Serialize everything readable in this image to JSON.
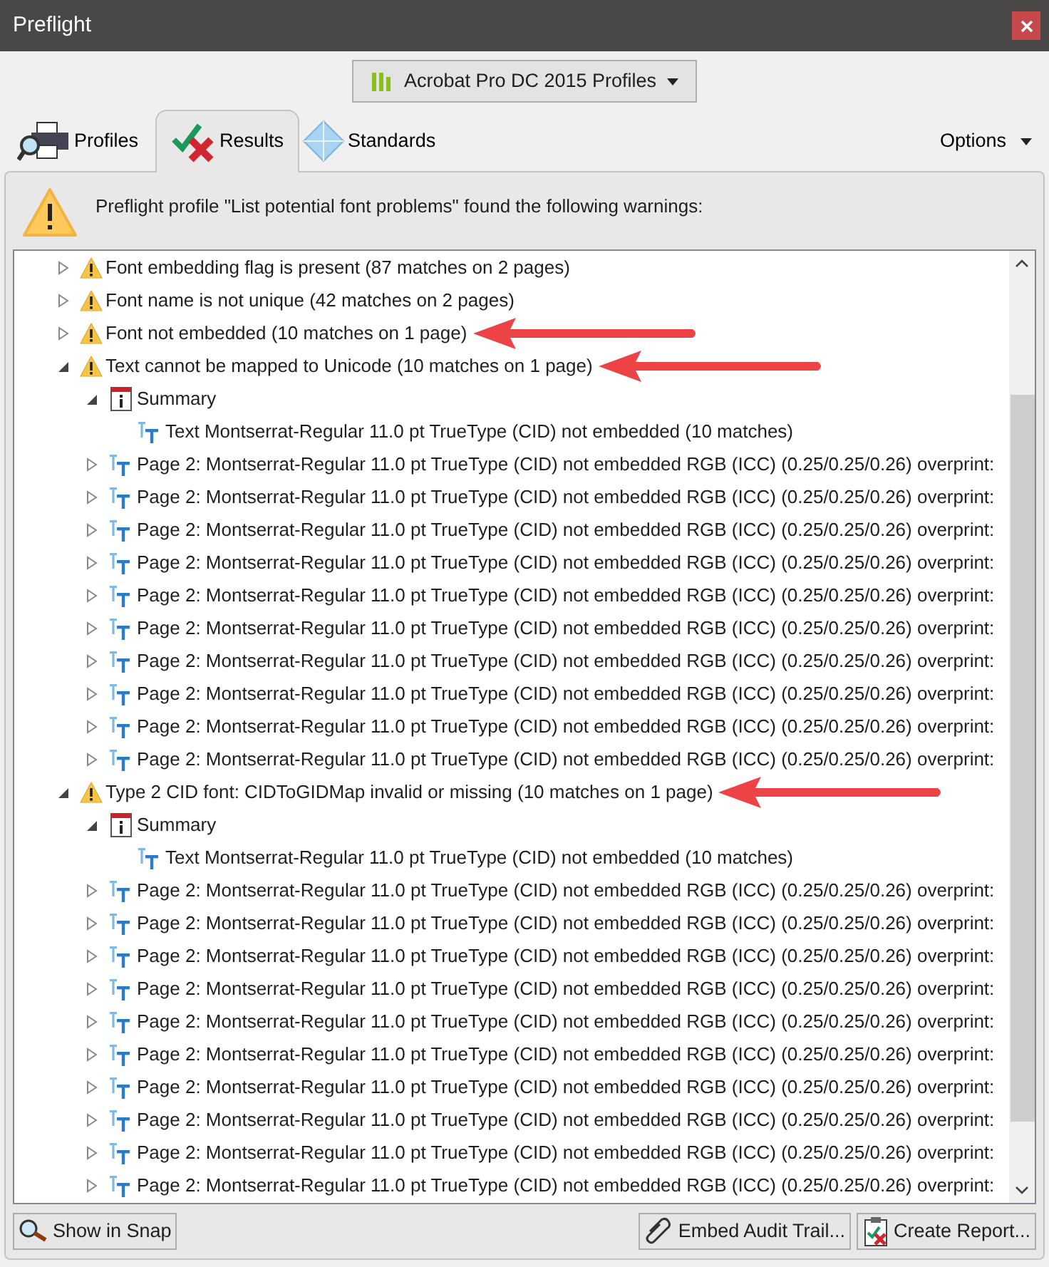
{
  "window": {
    "title": "Preflight"
  },
  "profile_selector": {
    "label": "Acrobat Pro DC 2015 Profiles"
  },
  "tabs": [
    {
      "kind": "profiles",
      "label": "Profiles",
      "selected": false
    },
    {
      "kind": "results",
      "label": "Results",
      "selected": true
    },
    {
      "kind": "standards",
      "label": "Standards",
      "selected": false
    }
  ],
  "options_menu": {
    "label": "Options"
  },
  "message": "Preflight profile \"List potential font problems\" found the following warnings:",
  "results": [
    {
      "kind": "warning",
      "label": "Font embedding flag is present (87 matches on 2 pages)",
      "expanded": false,
      "annotated": false
    },
    {
      "kind": "warning",
      "label": "Font name is not unique (42 matches on 2 pages)",
      "expanded": false,
      "annotated": false
    },
    {
      "kind": "warning",
      "label": "Font not embedded (10 matches on 1 page)",
      "expanded": false,
      "annotated": true
    },
    {
      "kind": "warning",
      "label": "Text cannot be mapped to Unicode (10 matches on 1 page)",
      "expanded": true,
      "annotated": true,
      "children": [
        {
          "kind": "summary",
          "label": "Summary",
          "expanded": true,
          "children": [
            {
              "kind": "text",
              "label": "Text Montserrat-Regular 11.0 pt TrueType (CID) not embedded (10 matches)"
            }
          ]
        },
        {
          "kind": "text",
          "label": "Page 2: Montserrat-Regular 11.0 pt TrueType (CID) not embedded RGB (ICC) (0.25/0.25/0.26)  overprint:",
          "expanded": false
        },
        {
          "kind": "text",
          "label": "Page 2: Montserrat-Regular 11.0 pt TrueType (CID) not embedded RGB (ICC) (0.25/0.25/0.26)  overprint:",
          "expanded": false
        },
        {
          "kind": "text",
          "label": "Page 2: Montserrat-Regular 11.0 pt TrueType (CID) not embedded RGB (ICC) (0.25/0.25/0.26)  overprint:",
          "expanded": false
        },
        {
          "kind": "text",
          "label": "Page 2: Montserrat-Regular 11.0 pt TrueType (CID) not embedded RGB (ICC) (0.25/0.25/0.26)  overprint:",
          "expanded": false
        },
        {
          "kind": "text",
          "label": "Page 2: Montserrat-Regular 11.0 pt TrueType (CID) not embedded RGB (ICC) (0.25/0.25/0.26)  overprint:",
          "expanded": false
        },
        {
          "kind": "text",
          "label": "Page 2: Montserrat-Regular 11.0 pt TrueType (CID) not embedded RGB (ICC) (0.25/0.25/0.26)  overprint:",
          "expanded": false
        },
        {
          "kind": "text",
          "label": "Page 2: Montserrat-Regular 11.0 pt TrueType (CID) not embedded RGB (ICC) (0.25/0.25/0.26)  overprint:",
          "expanded": false
        },
        {
          "kind": "text",
          "label": "Page 2: Montserrat-Regular 11.0 pt TrueType (CID) not embedded RGB (ICC) (0.25/0.25/0.26)  overprint:",
          "expanded": false
        },
        {
          "kind": "text",
          "label": "Page 2: Montserrat-Regular 11.0 pt TrueType (CID) not embedded RGB (ICC) (0.25/0.25/0.26)  overprint:",
          "expanded": false
        },
        {
          "kind": "text",
          "label": "Page 2: Montserrat-Regular 11.0 pt TrueType (CID) not embedded RGB (ICC) (0.25/0.25/0.26)  overprint:",
          "expanded": false
        }
      ]
    },
    {
      "kind": "warning",
      "label": "Type 2 CID font: CIDToGIDMap invalid or missing (10 matches on 1 page)",
      "expanded": true,
      "annotated": true,
      "children": [
        {
          "kind": "summary",
          "label": "Summary",
          "expanded": true,
          "children": [
            {
              "kind": "text",
              "label": "Text Montserrat-Regular 11.0 pt TrueType (CID) not embedded (10 matches)"
            }
          ]
        },
        {
          "kind": "text",
          "label": "Page 2: Montserrat-Regular 11.0 pt TrueType (CID) not embedded RGB (ICC) (0.25/0.25/0.26)  overprint:",
          "expanded": false
        },
        {
          "kind": "text",
          "label": "Page 2: Montserrat-Regular 11.0 pt TrueType (CID) not embedded RGB (ICC) (0.25/0.25/0.26)  overprint:",
          "expanded": false
        },
        {
          "kind": "text",
          "label": "Page 2: Montserrat-Regular 11.0 pt TrueType (CID) not embedded RGB (ICC) (0.25/0.25/0.26)  overprint:",
          "expanded": false
        },
        {
          "kind": "text",
          "label": "Page 2: Montserrat-Regular 11.0 pt TrueType (CID) not embedded RGB (ICC) (0.25/0.25/0.26)  overprint:",
          "expanded": false
        },
        {
          "kind": "text",
          "label": "Page 2: Montserrat-Regular 11.0 pt TrueType (CID) not embedded RGB (ICC) (0.25/0.25/0.26)  overprint:",
          "expanded": false
        },
        {
          "kind": "text",
          "label": "Page 2: Montserrat-Regular 11.0 pt TrueType (CID) not embedded RGB (ICC) (0.25/0.25/0.26)  overprint:",
          "expanded": false
        },
        {
          "kind": "text",
          "label": "Page 2: Montserrat-Regular 11.0 pt TrueType (CID) not embedded RGB (ICC) (0.25/0.25/0.26)  overprint:",
          "expanded": false
        },
        {
          "kind": "text",
          "label": "Page 2: Montserrat-Regular 11.0 pt TrueType (CID) not embedded RGB (ICC) (0.25/0.25/0.26)  overprint:",
          "expanded": false
        },
        {
          "kind": "text",
          "label": "Page 2: Montserrat-Regular 11.0 pt TrueType (CID) not embedded RGB (ICC) (0.25/0.25/0.26)  overprint:",
          "expanded": false
        },
        {
          "kind": "text",
          "label": "Page 2: Montserrat-Regular 11.0 pt TrueType (CID) not embedded RGB (ICC) (0.25/0.25/0.26)  overprint:",
          "expanded": false
        }
      ]
    }
  ],
  "buttons": [
    {
      "kind": "snap",
      "label": "Show in Snap"
    },
    {
      "kind": "audit",
      "label": "Embed Audit Trail..."
    },
    {
      "kind": "report",
      "label": "Create Report..."
    }
  ]
}
